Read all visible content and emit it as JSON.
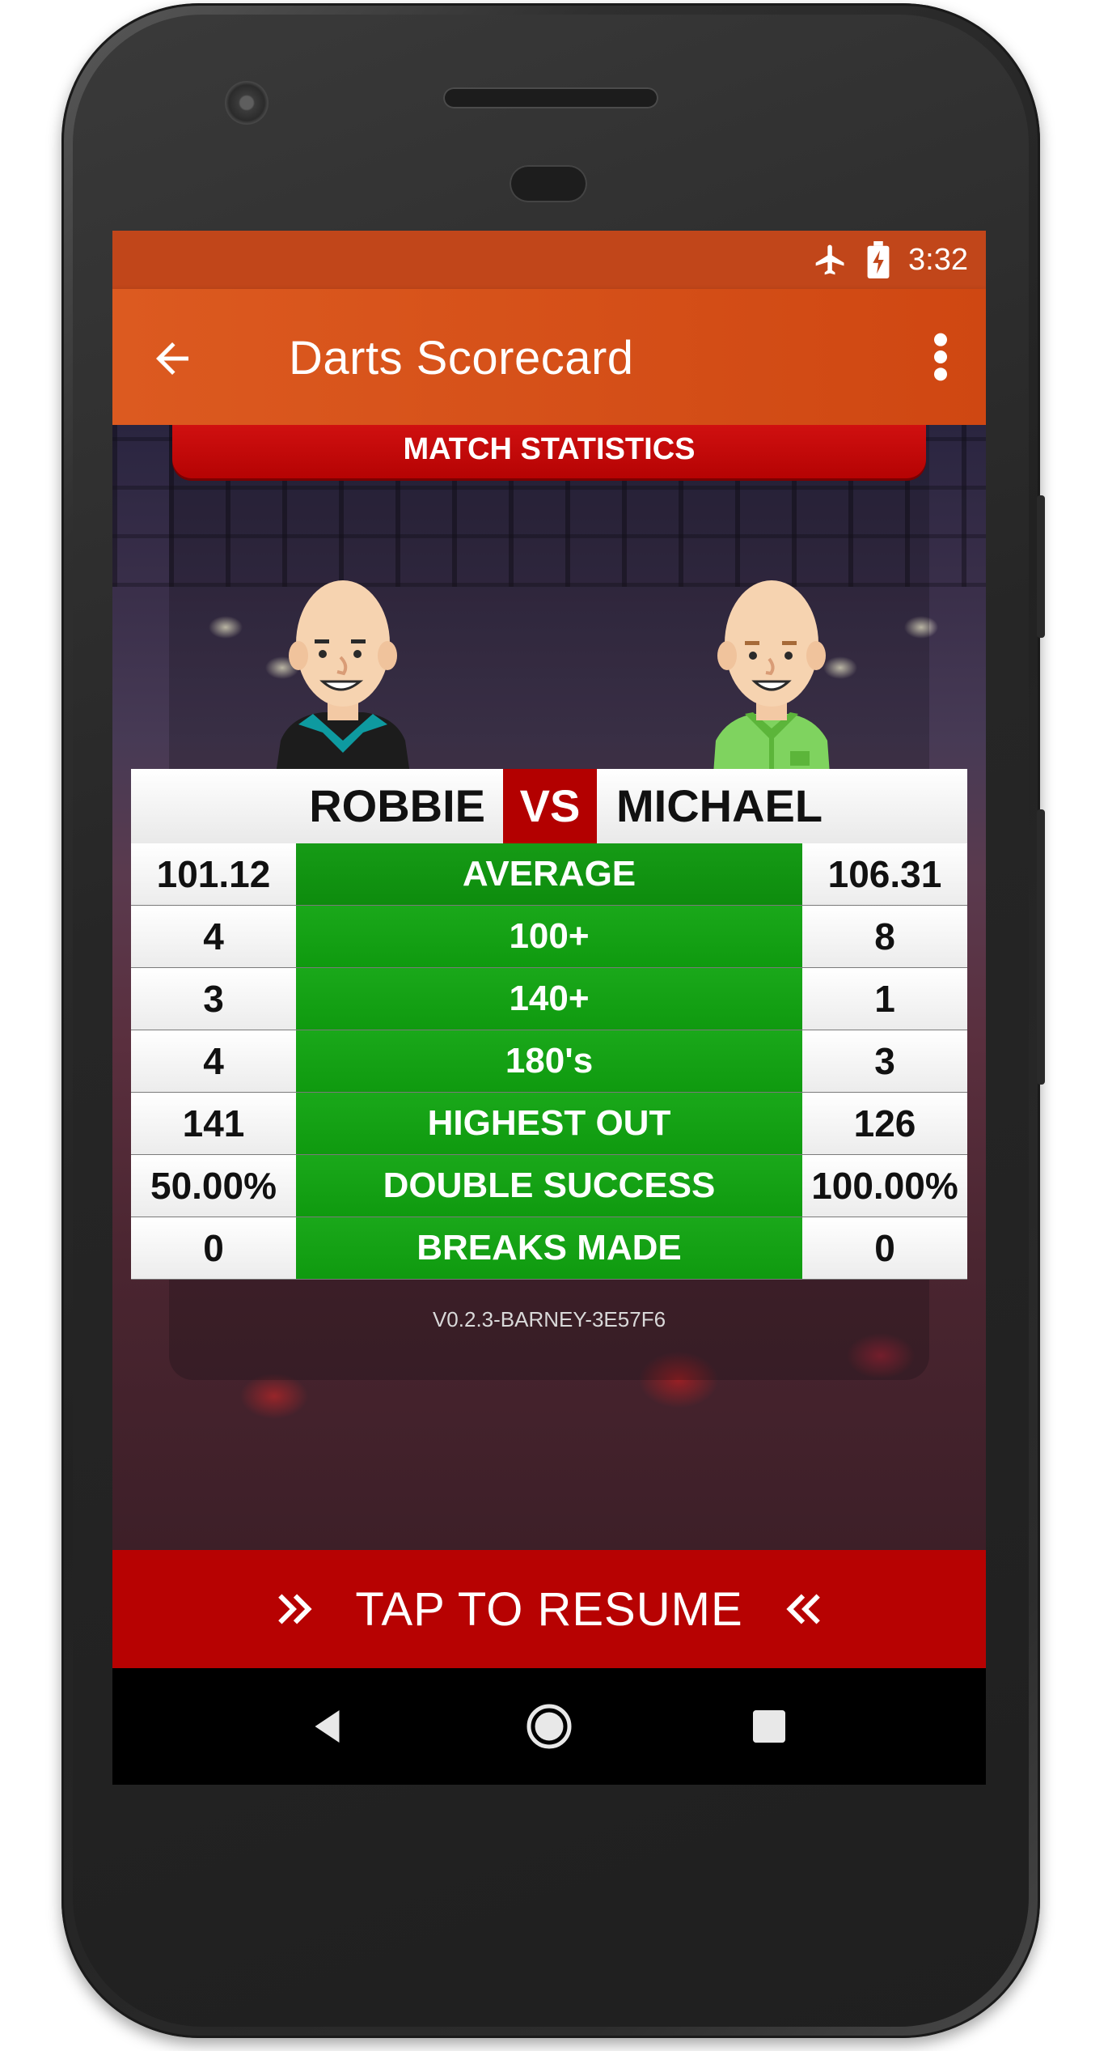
{
  "status_bar": {
    "time": "3:32",
    "icons": [
      "airplane-mode-icon",
      "battery-charging-icon"
    ]
  },
  "app_bar": {
    "title": "Darts Scorecard",
    "back_icon": "arrow-left-icon",
    "menu_icon": "more-vert-icon"
  },
  "stats": {
    "header": "MATCH STATISTICS",
    "player_left": "ROBBIE",
    "vs": "VS",
    "player_right": "MICHAEL",
    "rows": [
      {
        "label": "AVERAGE",
        "left": "101.12",
        "right": "106.31"
      },
      {
        "label": "100+",
        "left": "4",
        "right": "8"
      },
      {
        "label": "140+",
        "left": "3",
        "right": "1"
      },
      {
        "label": "180's",
        "left": "4",
        "right": "3"
      },
      {
        "label": "HIGHEST OUT",
        "left": "141",
        "right": "126"
      },
      {
        "label": "DOUBLE SUCCESS",
        "left": "50.00%",
        "right": "100.00%"
      },
      {
        "label": "BREAKS MADE",
        "left": "0",
        "right": "0"
      }
    ],
    "version": "V0.2.3-BARNEY-3E57F6"
  },
  "resume": {
    "label": "TAP TO RESUME"
  },
  "nav": {
    "back": "back-triangle-icon",
    "home": "home-circle-icon",
    "recents": "recents-square-icon"
  },
  "colors": {
    "app_bar": "#d4511a",
    "status_bar": "#c1461a",
    "red": "#b70202",
    "green": "#11a011"
  }
}
